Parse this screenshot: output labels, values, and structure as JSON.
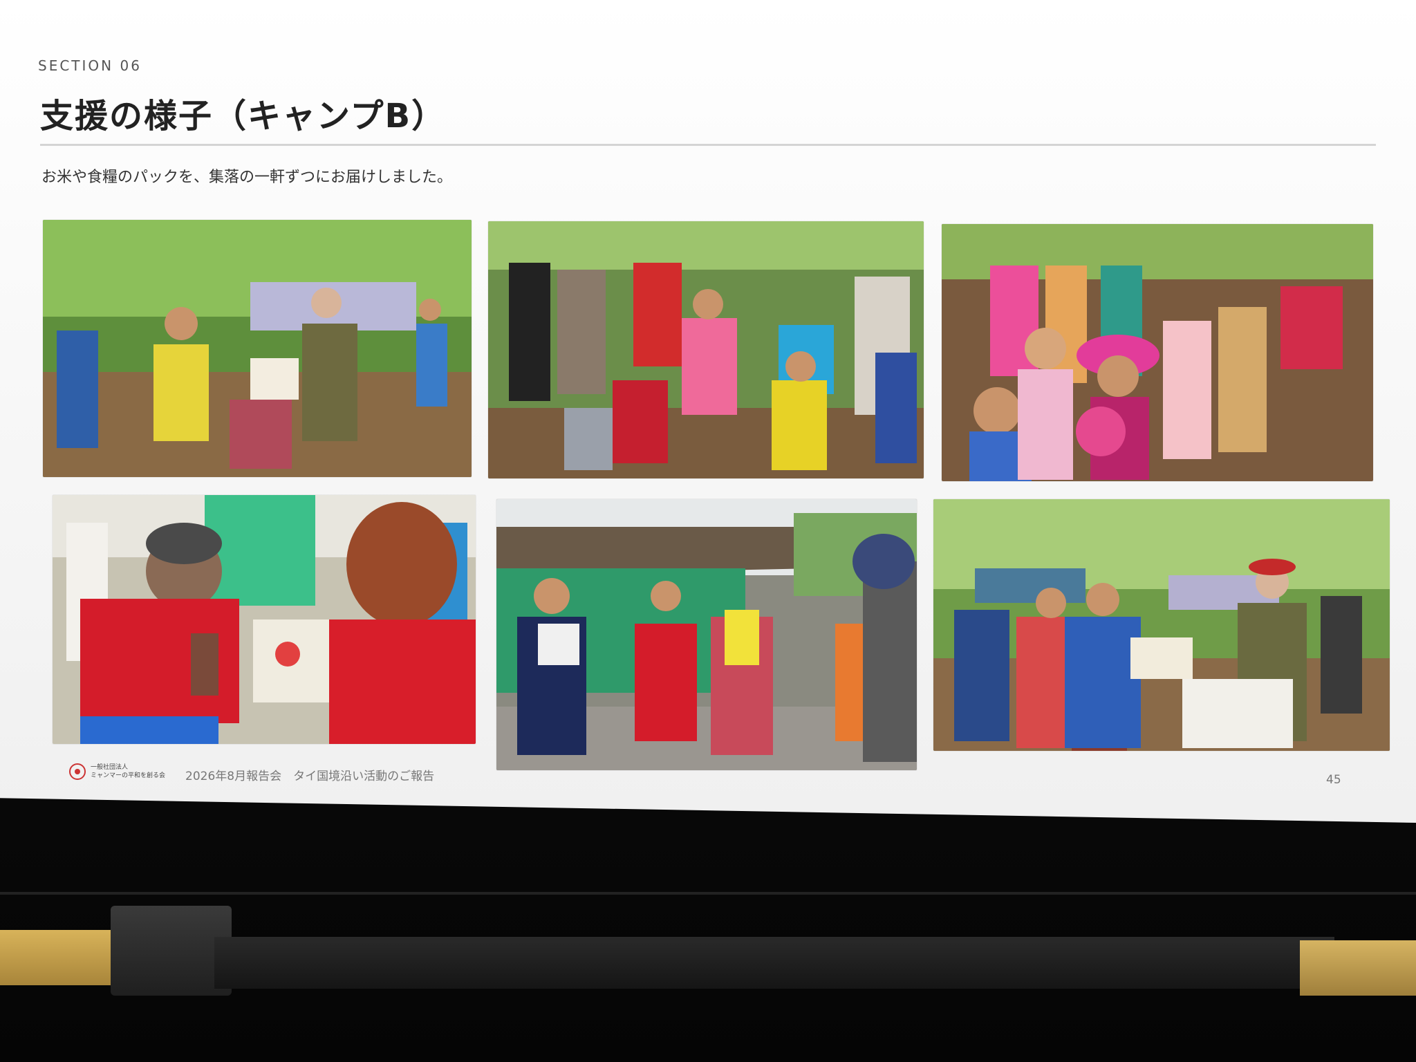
{
  "slide": {
    "section_label": "SECTION 06",
    "title": "支援の様子（キャンプB）",
    "subtitle": "お米や食糧のパックを、集落の一軒ずつにお届けしました。",
    "footer_org_line1": "一般社団法人",
    "footer_org_line2": "ミャンマーの平和を創る会",
    "footer_report": "2026年8月報告会　タイ国境沿い活動のご報告",
    "page_number": "45"
  },
  "photos": [
    {
      "name": "photo-aid-handover-outdoor",
      "accent": "#6aa84f"
    },
    {
      "name": "photo-crowd-families",
      "accent": "#e06666"
    },
    {
      "name": "photo-children-crowd",
      "accent": "#c27ba0"
    },
    {
      "name": "photo-elder-receiving-pack",
      "accent": "#cc0000"
    },
    {
      "name": "photo-villagers-by-hut",
      "accent": "#3d85c6"
    },
    {
      "name": "photo-distribution-line",
      "accent": "#93c47d"
    }
  ]
}
